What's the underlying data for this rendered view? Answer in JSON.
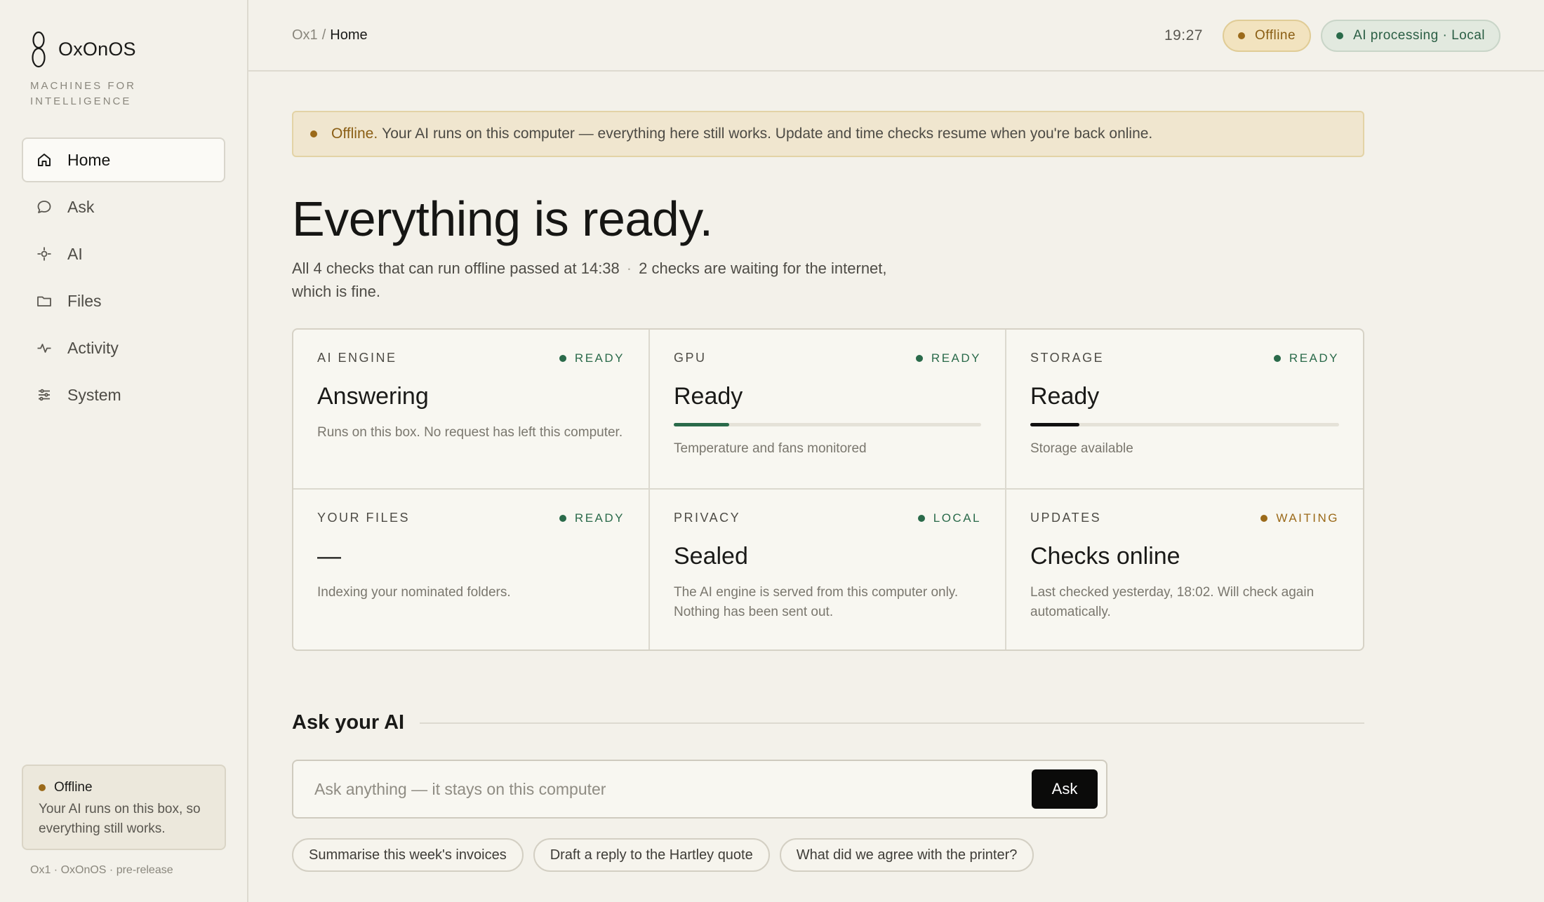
{
  "brand": {
    "name": "OxOnOS",
    "tagline": "MACHINES FOR INTELLIGENCE"
  },
  "sidebar": {
    "items": [
      {
        "label": "Home",
        "icon": "home-icon",
        "active": true
      },
      {
        "label": "Ask",
        "icon": "chat-bubble-icon",
        "active": false
      },
      {
        "label": "AI",
        "icon": "sparkle-icon",
        "active": false
      },
      {
        "label": "Files",
        "icon": "folder-icon",
        "active": false
      },
      {
        "label": "Activity",
        "icon": "pulse-icon",
        "active": false
      },
      {
        "label": "System",
        "icon": "sliders-icon",
        "active": false
      }
    ],
    "status": {
      "title": "Offline",
      "text": "Your AI runs on this box, so everything still works."
    },
    "footer": "Ox1 · OxOnOS · pre-release"
  },
  "topbar": {
    "breadcrumb_root": "Ox1",
    "breadcrumb_sep": "/",
    "breadcrumb_current": "Home",
    "clock": "19:27",
    "pill_offline": "Offline",
    "pill_ai": "AI processing · Local"
  },
  "banner": {
    "strong": "Offline.",
    "text": "Your AI runs on this computer — everything here still works. Update and time checks resume when you're back online."
  },
  "hero": {
    "title": "Everything is ready.",
    "sub_a": "All 4 checks that can run offline passed at 14:38",
    "sub_sep": "·",
    "sub_b": "2 checks are waiting for the internet, which is fine."
  },
  "cards": [
    {
      "label": "AI ENGINE",
      "status": "READY",
      "value": "Answering",
      "desc": "Runs on this box. No request has left this computer."
    },
    {
      "label": "GPU",
      "status": "READY",
      "value": "Ready",
      "desc": "Temperature and fans monitored",
      "bar_fraction": 0.18
    },
    {
      "label": "STORAGE",
      "status": "READY",
      "value": "Ready",
      "desc": "Storage available",
      "bar_fraction": 0.16
    },
    {
      "label": "YOUR FILES",
      "status": "READY",
      "value": "—",
      "desc": "Indexing your nominated folders."
    },
    {
      "label": "PRIVACY",
      "status": "LOCAL",
      "value": "Sealed",
      "desc": "The AI engine is served from this computer only. Nothing has been sent out."
    },
    {
      "label": "UPDATES",
      "status": "WAITING",
      "value": "Checks online",
      "desc": "Last checked yesterday, 18:02. Will check again automatically."
    }
  ],
  "ask": {
    "title": "Ask your AI",
    "placeholder": "Ask anything — it stays on this computer",
    "button": "Ask",
    "suggestions": [
      "Summarise this week's invoices",
      "Draft a reply to the Hartley quote",
      "What did we agree with the printer?"
    ]
  },
  "colors": {
    "background": "#f3f1ea",
    "accent_green": "#2a6a4a",
    "accent_amber": "#9b6a1a",
    "gpu_bar": "#2a6a4a",
    "storage_bar": "#111111"
  }
}
